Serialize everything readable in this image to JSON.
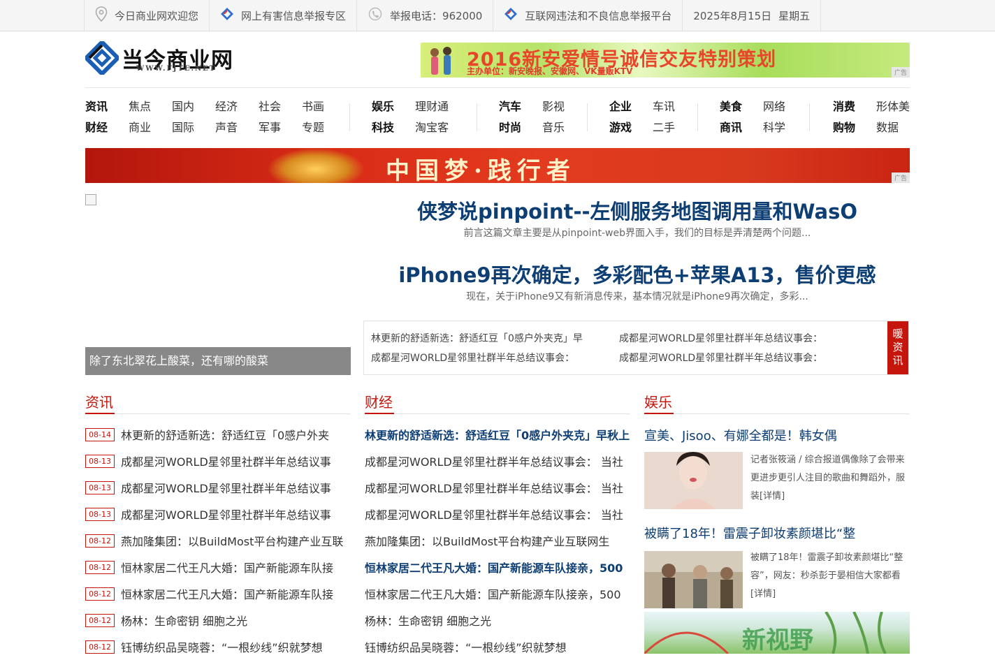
{
  "topbar": {
    "welcome": "今日商业网欢迎您",
    "report_zone": "网上有害信息举报专区",
    "hotline": "举报电话：962000",
    "platform": "互联网违法和不良信息举报平台",
    "date": "2025年8月15日",
    "weekday": "星期五"
  },
  "logo": {
    "name": "当今商业网",
    "url": "WWW.FJTE.NET"
  },
  "top_ad": {
    "title": "2016新安爱情号诚信交友特别策划",
    "sponsor": "主办单位：新安晚报、安徽网、VK量贩KTV",
    "tag": "广告"
  },
  "nav": {
    "groups": [
      [
        "资讯",
        "财经",
        "焦点",
        "商业",
        "国内",
        "国际",
        "经济",
        "声音",
        "社会",
        "军事",
        "书画",
        "专题"
      ],
      [
        "娱乐",
        "科技",
        "理财通",
        "淘宝客"
      ],
      [
        "汽车",
        "时尚",
        "影视",
        "音乐"
      ],
      [
        "企业",
        "游戏",
        "车讯",
        "二手"
      ],
      [
        "美食",
        "商讯",
        "网络",
        "科学"
      ],
      [
        "消费",
        "购物",
        "形体美",
        "数据"
      ]
    ]
  },
  "banner": {
    "text": "中国梦·践行者",
    "tag": "广告"
  },
  "hero": {
    "caption": "除了东北翠花上酸菜，还有哪的酸菜",
    "headline1": "侠梦说pinpoint--左侧服务地图调用量和WasO",
    "summary1": "前言这篇文章主要是从pinpoint-web界面入手，我们的目标是弄清楚两个问题...",
    "headline2": "iPhone9再次确定，多彩配色+苹果A13，售价更感",
    "summary2": "现在，关于iPhone9又有新消息传来，基本情况就是iPhone9再次确定，多彩..."
  },
  "ticker": {
    "label": "暖资讯",
    "items": [
      "林更新的舒适新选：舒适红豆「0感户外夹克」早",
      "成都星河WORLD星邻里社群半年总结议事会：",
      "成都星河WORLD星邻里社群半年总结议事会：",
      "成都星河WORLD星邻里社群半年总结议事会："
    ]
  },
  "zixun": {
    "title": "资讯",
    "items": [
      {
        "date": "08-14",
        "text": "林更新的舒适新选：舒适红豆「0感户外夹"
      },
      {
        "date": "08-13",
        "text": "成都星河WORLD星邻里社群半年总结议事"
      },
      {
        "date": "08-13",
        "text": "成都星河WORLD星邻里社群半年总结议事"
      },
      {
        "date": "08-13",
        "text": "成都星河WORLD星邻里社群半年总结议事"
      },
      {
        "date": "08-12",
        "text": "燕加隆集团：以BuildMost平台构建产业互联"
      },
      {
        "date": "08-12",
        "text": "恒林家居二代王凡大婚：国产新能源车队接"
      },
      {
        "date": "08-12",
        "text": "恒林家居二代王凡大婚：国产新能源车队接"
      },
      {
        "date": "08-12",
        "text": "杨林：生命密钥 细胞之光"
      },
      {
        "date": "08-12",
        "text": "钰博纺织品吴晓蓉：“一根纱线”织就梦想"
      }
    ]
  },
  "caijing": {
    "title": "财经",
    "items": [
      {
        "text": "林更新的舒适新选：舒适红豆「0感户外夹克」早秋上",
        "bold": true
      },
      {
        "text": "成都星河WORLD星邻里社群半年总结议事会： 当社",
        "bold": false
      },
      {
        "text": "成都星河WORLD星邻里社群半年总结议事会： 当社",
        "bold": false
      },
      {
        "text": "成都星河WORLD星邻里社群半年总结议事会： 当社",
        "bold": false
      },
      {
        "text": "燕加隆集团：以BuildMost平台构建产业互联网生",
        "bold": false
      },
      {
        "text": "恒林家居二代王凡大婚：国产新能源车队接亲，500",
        "bold": true
      },
      {
        "text": "恒林家居二代王凡大婚：国产新能源车队接亲，500",
        "bold": false
      },
      {
        "text": "杨林：生命密钥 细胞之光",
        "bold": false
      },
      {
        "text": "钰博纺织品吴晓蓉：“一根纱线”织就梦想",
        "bold": false
      }
    ]
  },
  "yule": {
    "title": "娱乐",
    "story1": {
      "headline": "宣美、Jisoo、有娜全都是！韩女偶",
      "desc": "记者张筱涵 / 综合报道偶像除了会带来更进步更引人注目的歌曲和舞蹈外，服装[详情]"
    },
    "story2": {
      "headline": "被瞒了18年！雷震子卸妆素颜堪比“整",
      "desc": "被瞒了18年！雷震子卸妆素颜堪比“整容”，网友：秒杀彭于晏相信大家都看[详情]"
    }
  },
  "colors": {
    "accent_red": "#c5160d",
    "headline_blue": "#0d3e74"
  }
}
